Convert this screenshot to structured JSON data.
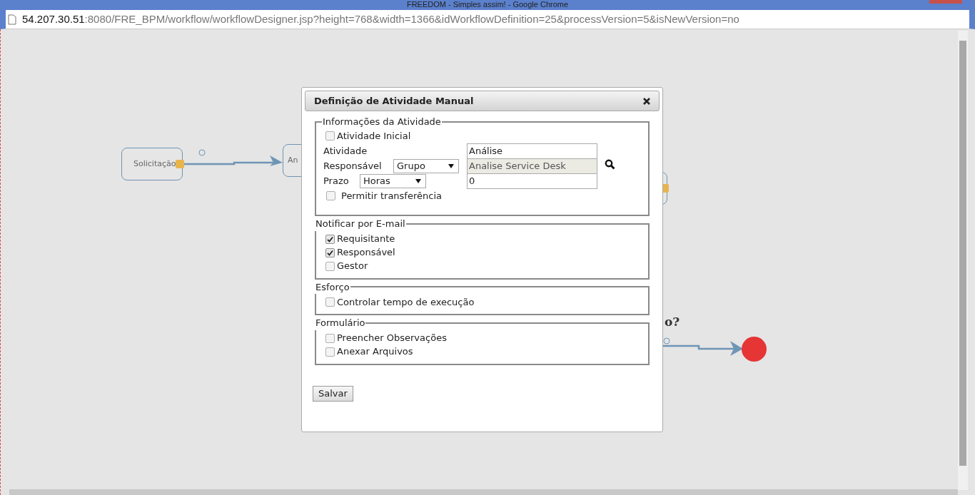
{
  "window": {
    "title": "FREEDOM - Simples assim! - Google Chrome"
  },
  "address_bar": {
    "host": "54.207.30.51",
    "path": ":8080/FRE_BPM/workflow/workflowDesigner.jsp?height=768&width=1366&idWorkflowDefinition=25&processVersion=5&isNewVersion=no"
  },
  "canvas": {
    "nodes": [
      {
        "kind": "activity",
        "label": "Solicitação"
      },
      {
        "kind": "activity",
        "label": "An"
      },
      {
        "kind": "activity"
      },
      {
        "kind": "gateway",
        "label": "o?"
      },
      {
        "kind": "end"
      }
    ]
  },
  "dialog": {
    "title": "Definição de Atividade Manual",
    "info": {
      "legend": "Informações da Atividade",
      "initial": {
        "label": "Atividade Inicial",
        "checked": false
      },
      "activity": {
        "label": "Atividade",
        "value": "Análise"
      },
      "responsible": {
        "label": "Responsável",
        "option": "Grupo",
        "value": "Analise Service Desk",
        "disabled": true
      },
      "deadline": {
        "label": "Prazo",
        "option": "Horas",
        "value": "0"
      },
      "transfer": {
        "label": "Permitir transferência",
        "checked": false
      }
    },
    "groups": [
      {
        "legend": "Notificar por E-mail",
        "items": [
          {
            "label": "Requisitante",
            "checked": true
          },
          {
            "label": "Responsável",
            "checked": true
          },
          {
            "label": "Gestor",
            "checked": false
          }
        ]
      },
      {
        "legend": "Esforço",
        "items": [
          {
            "label": "Controlar tempo de execução",
            "checked": false
          }
        ]
      },
      {
        "legend": "Formulário",
        "items": [
          {
            "label": "Preencher Observações",
            "checked": false
          },
          {
            "label": "Anexar Arquivos",
            "checked": false
          }
        ]
      }
    ],
    "save": "Salvar"
  }
}
